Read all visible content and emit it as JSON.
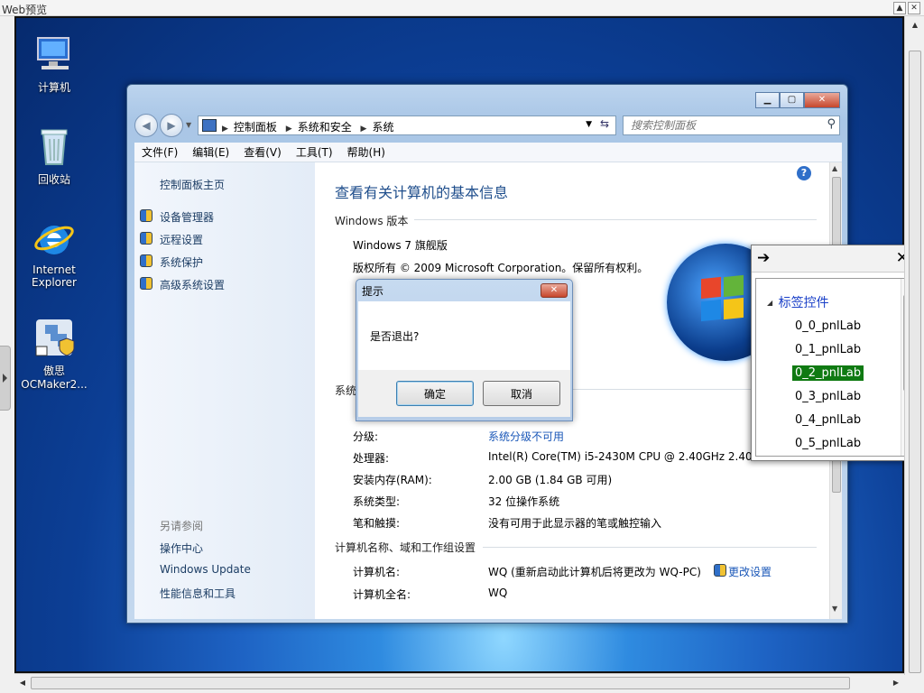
{
  "host": {
    "title": "Web预览"
  },
  "desktop": {
    "icons": [
      {
        "label": "计算机"
      },
      {
        "label": "回收站"
      },
      {
        "label": "Internet Explorer"
      },
      {
        "label": "傲思 OCMaker2..."
      }
    ]
  },
  "window": {
    "breadcrumbs": [
      "控制面板",
      "系统和安全",
      "系统"
    ],
    "search_placeholder": "搜索控制面板",
    "menu": [
      "文件(F)",
      "编辑(E)",
      "查看(V)",
      "工具(T)",
      "帮助(H)"
    ],
    "left": {
      "home": "控制面板主页",
      "links": [
        "设备管理器",
        "远程设置",
        "系统保护",
        "高级系统设置"
      ],
      "see_also": "另请参阅",
      "see_also_links": [
        "操作中心",
        "Windows Update",
        "性能信息和工具"
      ]
    },
    "main": {
      "heading": "查看有关计算机的基本信息",
      "edition_section": "Windows 版本",
      "edition": "Windows 7 旗舰版",
      "copyright": "版权所有 © 2009 Microsoft Corporation。保留所有权利。",
      "system_section": "系统",
      "rows": [
        {
          "label": "分级:",
          "value": "系统分级不可用",
          "link": true
        },
        {
          "label": "处理器:",
          "value": "Intel(R) Core(TM) i5-2430M CPU @ 2.40GHz   2.40",
          "link": false
        },
        {
          "label": "安装内存(RAM):",
          "value": "2.00 GB (1.84 GB 可用)",
          "link": false
        },
        {
          "label": "系统类型:",
          "value": "32 位操作系统",
          "link": false
        },
        {
          "label": "笔和触摸:",
          "value": "没有可用于此显示器的笔或触控输入",
          "link": false
        }
      ],
      "computer_section": "计算机名称、域和工作组设置",
      "computer_rows": [
        {
          "label": "计算机名:",
          "value": "WQ (重新启动此计算机后将更改为 WQ-PC)"
        },
        {
          "label": "计算机全名:",
          "value": "WQ"
        }
      ],
      "change_settings": "更改设置"
    }
  },
  "dialog": {
    "title": "提示",
    "message": "是否退出?",
    "ok": "确定",
    "cancel": "取消"
  },
  "tag_panel": {
    "root": "标签控件",
    "items": [
      "0_0_pnlLab",
      "0_1_pnlLab",
      "0_2_pnlLab",
      "0_3_pnlLab",
      "0_4_pnlLab",
      "0_5_pnlLab"
    ],
    "selected_index": 2,
    "selected_color": "#0f7a12"
  }
}
